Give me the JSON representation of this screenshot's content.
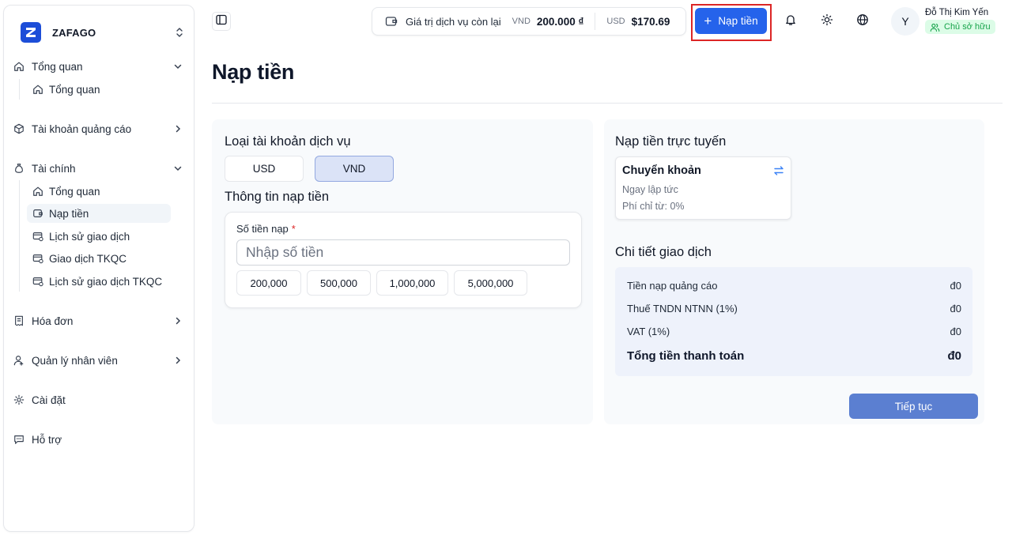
{
  "brand": {
    "name": "ZAFAGO",
    "logo_letter": "Z"
  },
  "sidebar": {
    "groups": [
      {
        "label": "Tổng quan",
        "icon": "home-icon",
        "expanded": true,
        "children": [
          {
            "label": "Tổng quan",
            "icon": "home-icon"
          }
        ]
      },
      {
        "label": "Tài khoản quảng cáo",
        "icon": "cube-icon",
        "expanded": false
      },
      {
        "label": "Tài chính",
        "icon": "money-bag-icon",
        "expanded": true,
        "children": [
          {
            "label": "Tổng quan",
            "icon": "home-icon"
          },
          {
            "label": "Nạp tiền",
            "icon": "wallet-icon",
            "active": true
          },
          {
            "label": "Lịch sử giao dịch",
            "icon": "card-history-icon"
          },
          {
            "label": "Giao dịch TKQC",
            "icon": "card-history-icon"
          },
          {
            "label": "Lịch sử giao dịch TKQC",
            "icon": "card-history-icon"
          }
        ]
      },
      {
        "label": "Hóa đơn",
        "icon": "receipt-icon",
        "expanded": false
      },
      {
        "label": "Quản lý nhân viên",
        "icon": "user-icon",
        "expanded": false
      },
      {
        "label": "Cài đặt",
        "icon": "gear-icon"
      },
      {
        "label": "Hỗ trợ",
        "icon": "chat-icon"
      }
    ]
  },
  "topbar": {
    "balance_label": "Giá trị dịch vụ còn lại",
    "vnd_currency": "VND",
    "vnd_amount": "200.000 ₫",
    "usd_currency": "USD",
    "usd_amount": "$170.69",
    "topup_label": "Nạp tiền",
    "user_initial": "Y",
    "user_name": "Đỗ Thị Kim Yến",
    "user_role": "Chủ sở hữu"
  },
  "page": {
    "title": "Nạp tiền"
  },
  "left": {
    "account_type_title": "Loại tài khoản dịch vụ",
    "account_types": [
      "USD",
      "VND"
    ],
    "selected_type": "VND",
    "info_title": "Thông tin nạp tiền",
    "amount_label": "Số tiền nạp",
    "required_mark": "*",
    "amount_placeholder": "Nhập số tiền",
    "presets": [
      "200,000",
      "500,000",
      "1,000,000",
      "5,000,000"
    ]
  },
  "right": {
    "online_title": "Nạp tiền trực tuyến",
    "method_title": "Chuyển khoản",
    "method_speed": "Ngay lập tức",
    "method_fee": "Phí chỉ từ: 0%",
    "detail_title": "Chi tiết giao dịch",
    "rows": [
      {
        "label": "Tiền nạp quảng cáo",
        "value": "đ0"
      },
      {
        "label": "Thuế TNDN NTNN (1%)",
        "value": "đ0"
      },
      {
        "label": "VAT (1%)",
        "value": "đ0"
      }
    ],
    "total_label": "Tổng tiền thanh toán",
    "total_value": "đ0",
    "continue_label": "Tiếp tục"
  },
  "colors": {
    "primary": "#2563eb",
    "continue": "#5b7fd1",
    "highlight": "#dc2626",
    "role_badge_bg": "#dcfce7",
    "role_badge_fg": "#16a34a",
    "active_nav_bg": "#f1f5f9"
  }
}
